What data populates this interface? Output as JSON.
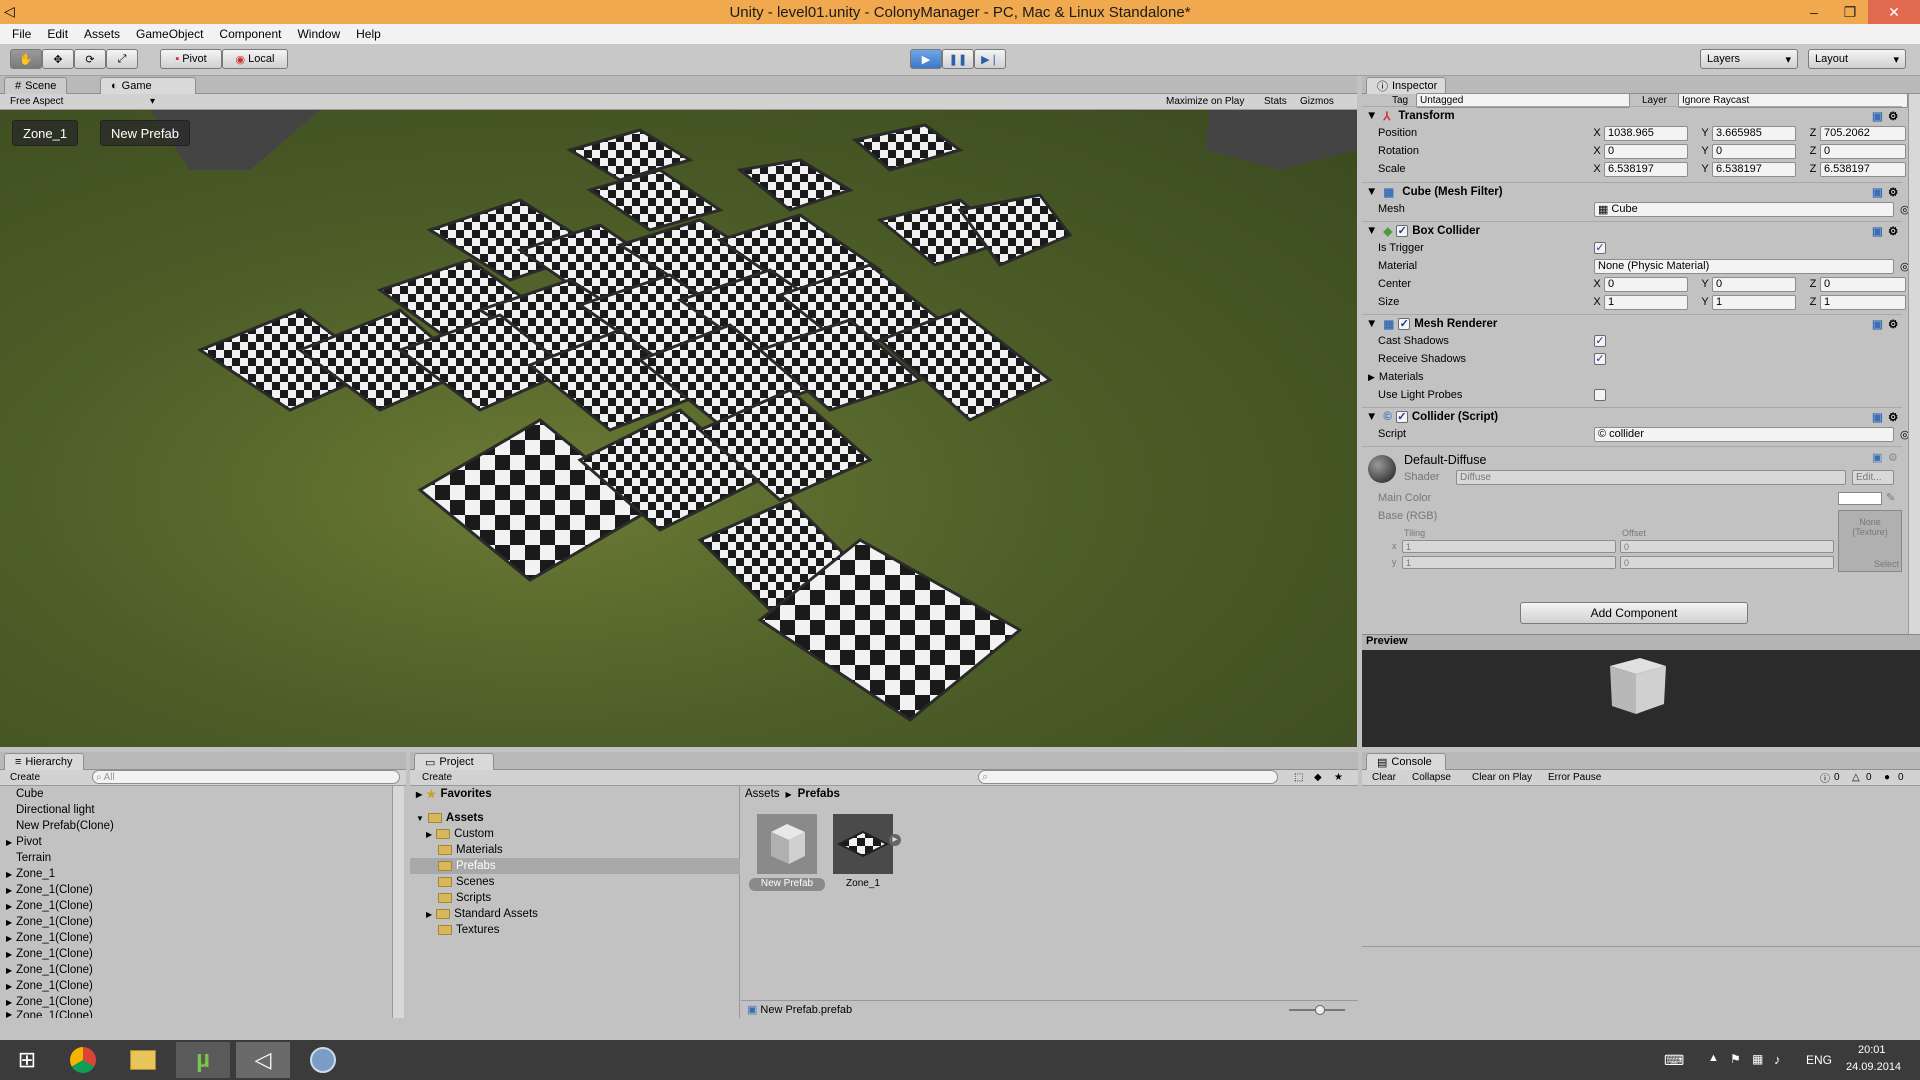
{
  "window": {
    "title": "Unity - level01.unity - ColonyManager - PC, Mac & Linux Standalone*",
    "min": "–",
    "max": "❐",
    "close": "✕"
  },
  "menu": [
    "File",
    "Edit",
    "Assets",
    "GameObject",
    "Component",
    "Window",
    "Help"
  ],
  "toolbar": {
    "pivot": "Pivot",
    "local": "Local",
    "layers": "Layers",
    "layout": "Layout"
  },
  "scene_tabs": {
    "scene": "Scene",
    "game": "Game"
  },
  "game_bar": {
    "aspect": "Free Aspect",
    "maximize": "Maximize on Play",
    "stats": "Stats",
    "gizmos": "Gizmos"
  },
  "game_overlay": {
    "btn1": "Zone_1",
    "btn2": "New Prefab"
  },
  "inspector": {
    "tab": "Inspector",
    "tag_label": "Tag",
    "tag_value": "Untagged",
    "layer_label": "Layer",
    "layer_value": "Ignore Raycast",
    "transform": {
      "title": "Transform",
      "position_label": "Position",
      "pos_x": "1038.965",
      "pos_y": "3.665985",
      "pos_z": "705.2062",
      "rotation_label": "Rotation",
      "rot_x": "0",
      "rot_y": "0",
      "rot_z": "0",
      "scale_label": "Scale",
      "sc_x": "6.538197",
      "sc_y": "6.538197",
      "sc_z": "6.538197"
    },
    "mesh_filter": {
      "title": "Cube (Mesh Filter)",
      "mesh_label": "Mesh",
      "mesh_value": "Cube"
    },
    "box_collider": {
      "title": "Box Collider",
      "trigger_label": "Is Trigger",
      "material_label": "Material",
      "material_value": "None (Physic Material)",
      "center_label": "Center",
      "c_x": "0",
      "c_y": "0",
      "c_z": "0",
      "size_label": "Size",
      "s_x": "1",
      "s_y": "1",
      "s_z": "1"
    },
    "mesh_renderer": {
      "title": "Mesh Renderer",
      "cast_label": "Cast Shadows",
      "receive_label": "Receive Shadows",
      "materials_label": "Materials",
      "probes_label": "Use Light Probes"
    },
    "collider_script": {
      "title": "Collider (Script)",
      "script_label": "Script",
      "script_value": "collider"
    },
    "material": {
      "name": "Default-Diffuse",
      "shader_label": "Shader",
      "shader_value": "Diffuse",
      "edit": "Edit...",
      "main_color": "Main Color",
      "base": "Base (RGB)",
      "tiling": "Tiling",
      "offset": "Offset",
      "x": "x",
      "y": "y",
      "tx": "1",
      "ty": "1",
      "ox": "0",
      "oy": "0",
      "tex_none": "None",
      "tex_type": "(Texture)",
      "select": "Select"
    },
    "add_component": "Add Component",
    "preview": "Preview"
  },
  "hierarchy": {
    "tab": "Hierarchy",
    "create": "Create",
    "search": "All",
    "items": [
      "Cube",
      "Directional light",
      "New Prefab(Clone)",
      "Pivot",
      "Terrain",
      "Zone_1",
      "Zone_1(Clone)",
      "Zone_1(Clone)",
      "Zone_1(Clone)",
      "Zone_1(Clone)",
      "Zone_1(Clone)",
      "Zone_1(Clone)",
      "Zone_1(Clone)",
      "Zone_1(Clone)",
      "Zone_1(Clone)"
    ]
  },
  "project": {
    "tab": "Project",
    "create": "Create",
    "favorites": "Favorites",
    "assets": "Assets",
    "folders": [
      "Custom",
      "Materials",
      "Prefabs",
      "Scenes",
      "Scripts",
      "Standard Assets",
      "Textures"
    ],
    "breadcrumb_root": "Assets",
    "breadcrumb_current": "Prefabs",
    "asset_items": [
      "New Prefab",
      "Zone_1"
    ],
    "status_file": "New Prefab.prefab"
  },
  "console": {
    "tab": "Console",
    "clear": "Clear",
    "collapse": "Collapse",
    "clear_on_play": "Clear on Play",
    "error_pause": "Error Pause",
    "info_count": "0",
    "warn_count": "0",
    "err_count": "0"
  },
  "taskbar": {
    "lang": "ENG",
    "time": "20:01",
    "date": "24.09.2014"
  }
}
